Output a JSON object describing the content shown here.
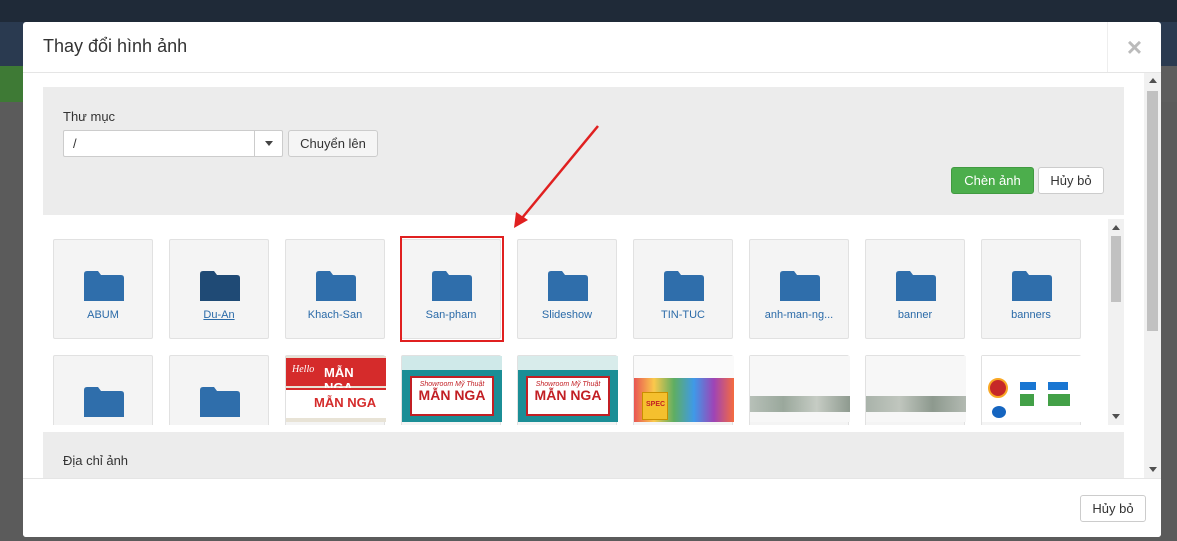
{
  "dialog": {
    "title": "Thay đổi hình ảnh",
    "close_icon": "close-icon"
  },
  "toolbar": {
    "folder_label": "Thư mục",
    "path_value": "/",
    "up_button": "Chuyển lên",
    "insert_button": "Chèn ảnh",
    "cancel_button": "Hủy bỏ"
  },
  "folders": [
    {
      "name": "ABUM"
    },
    {
      "name": "Du-An"
    },
    {
      "name": "Khach-San"
    },
    {
      "name": "San-pham"
    },
    {
      "name": "Slideshow"
    },
    {
      "name": "TIN-TUC"
    },
    {
      "name": "anh-man-ng..."
    },
    {
      "name": "banner"
    },
    {
      "name": "banners"
    }
  ],
  "second_row": {
    "sign_main": "MẪN NGA",
    "sign_sub": "Hello",
    "sign_showroom": "Showroom Mỹ Thuật",
    "paint_label": "SPEC"
  },
  "address": {
    "label": "Địa chỉ ảnh"
  },
  "footer": {
    "cancel_button": "Hủy bỏ"
  },
  "colors": {
    "folder": "#2f6eab",
    "folder_hover": "#1f4a75",
    "insert_button": "#4cae4c",
    "highlight": "#e02020"
  }
}
